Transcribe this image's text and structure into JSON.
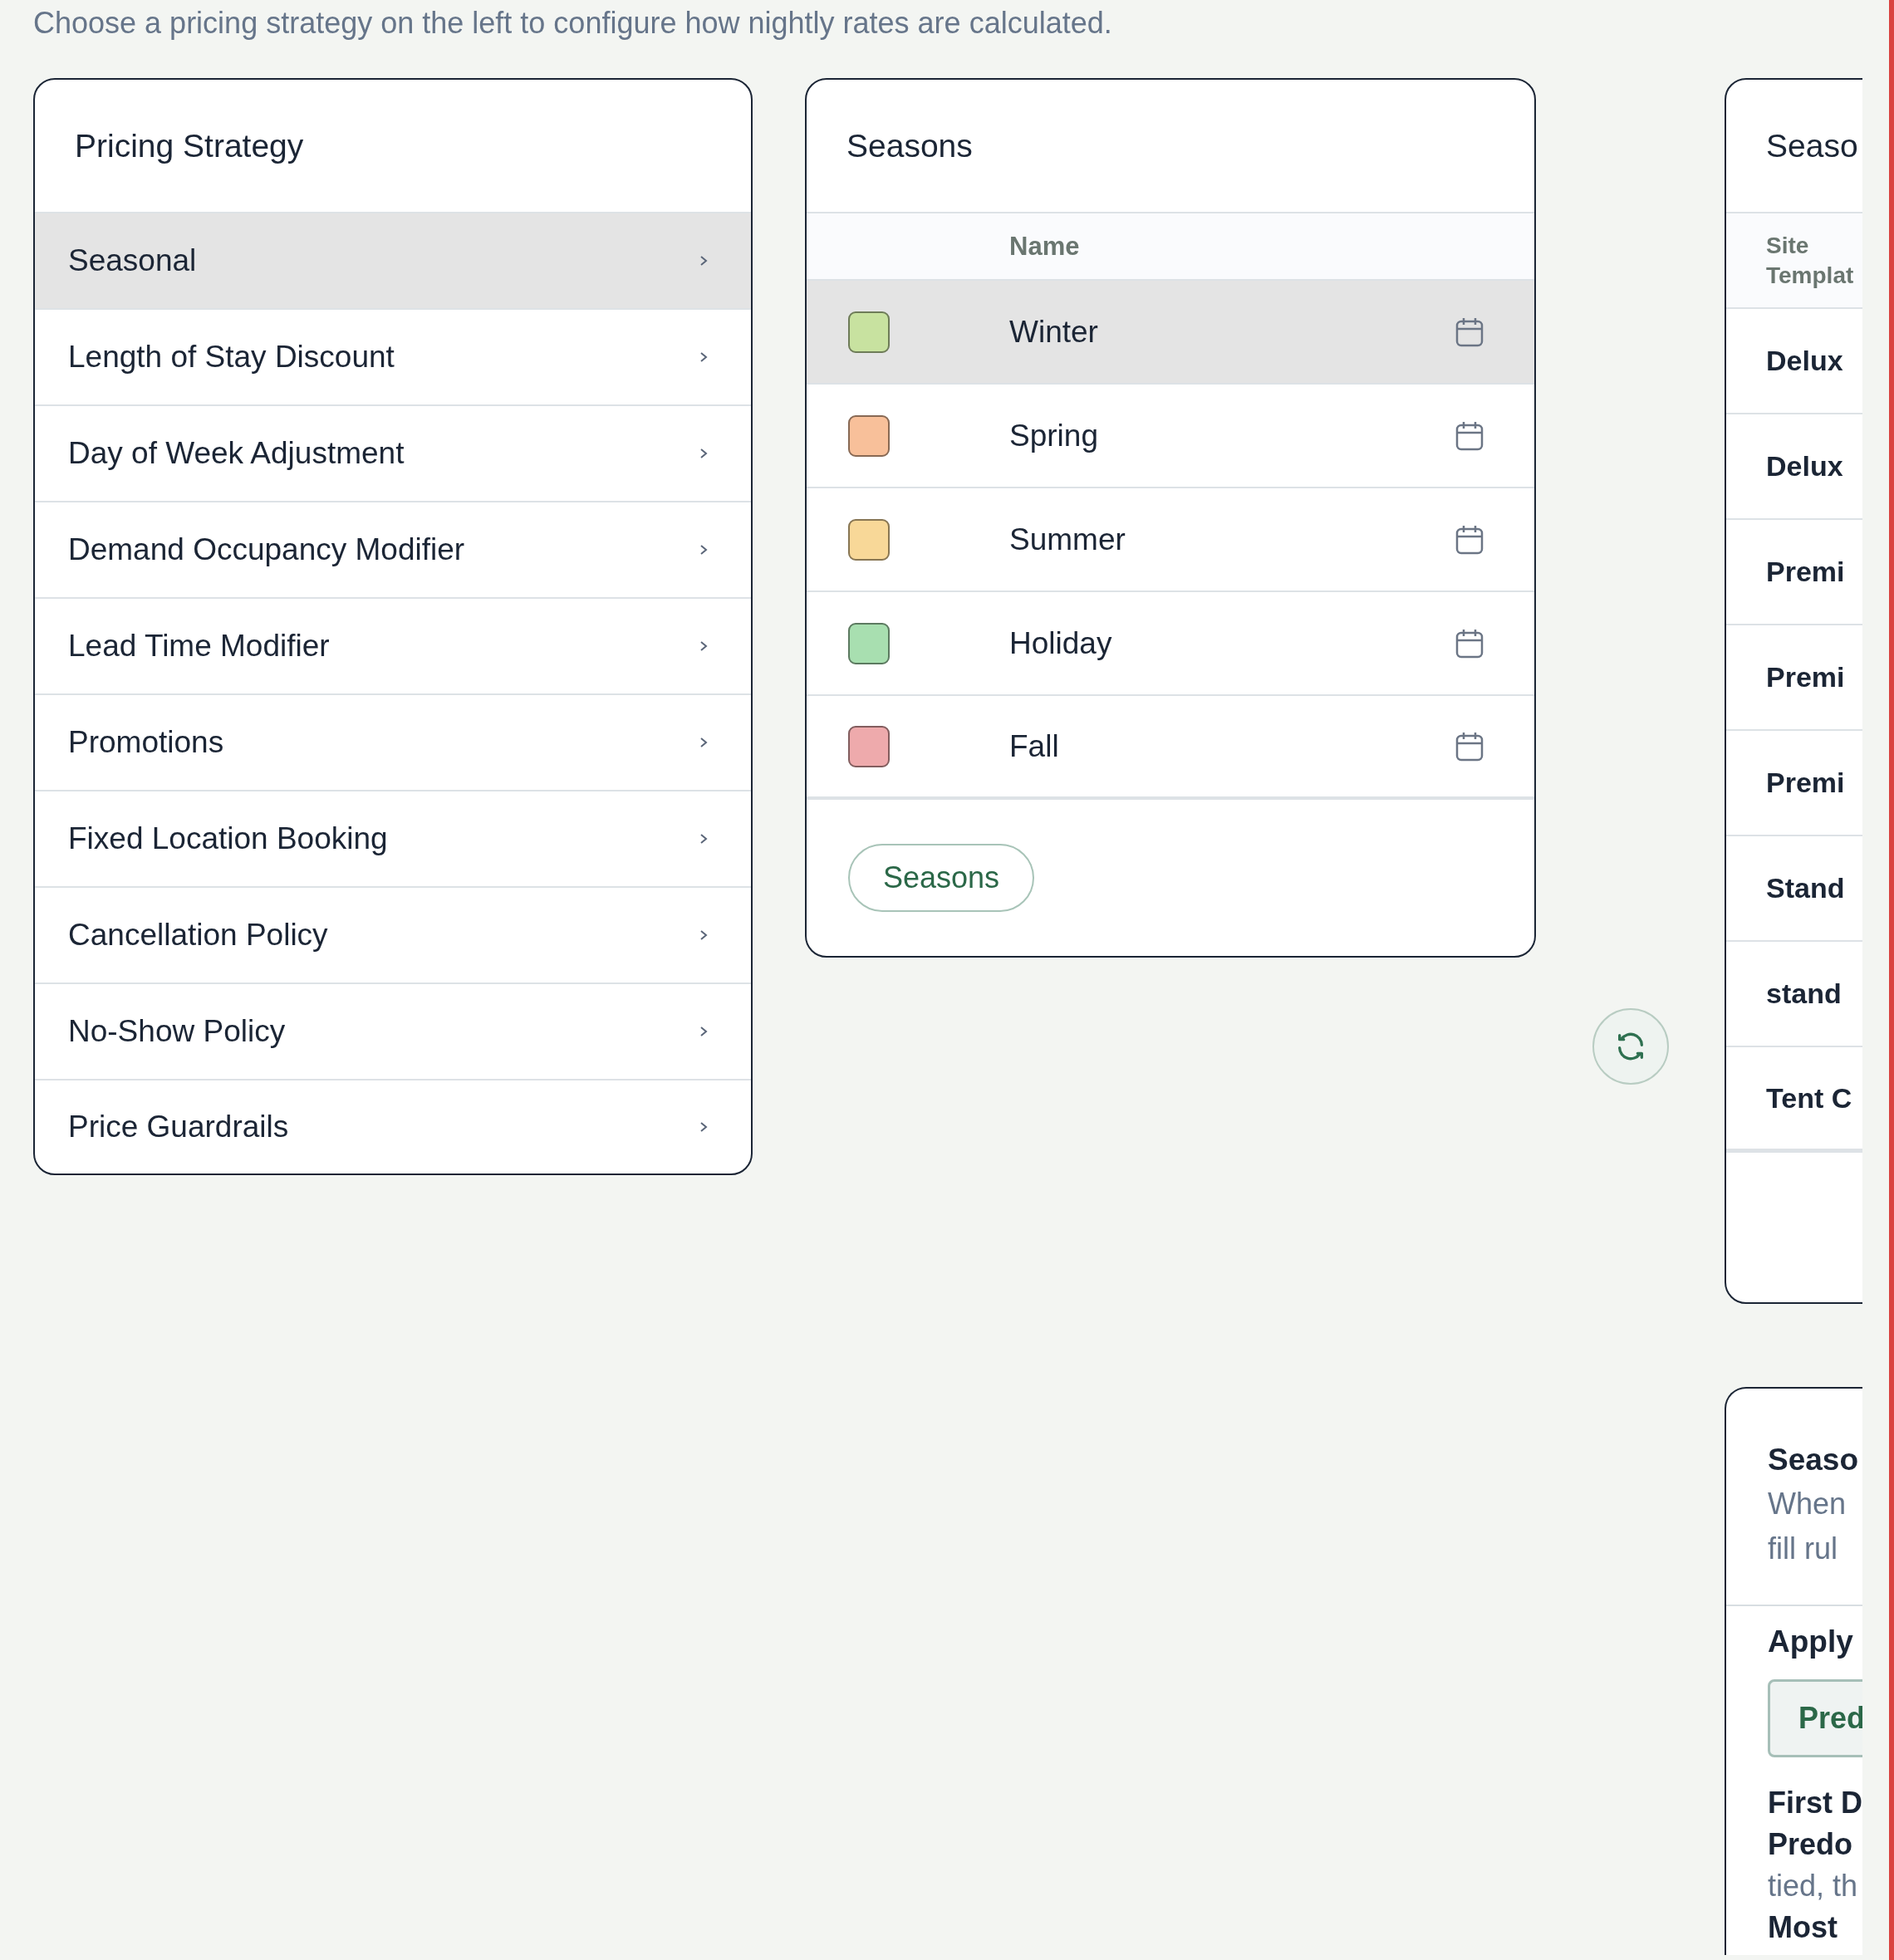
{
  "intro": "Choose a pricing strategy on the left to configure how nightly rates are calculated.",
  "strategy_panel": {
    "title": "Pricing Strategy",
    "items": [
      {
        "label": "Seasonal",
        "selected": true
      },
      {
        "label": "Length of Stay Discount",
        "selected": false
      },
      {
        "label": "Day of Week Adjustment",
        "selected": false
      },
      {
        "label": "Demand Occupancy Modifier",
        "selected": false
      },
      {
        "label": "Lead Time Modifier",
        "selected": false
      },
      {
        "label": "Promotions",
        "selected": false
      },
      {
        "label": "Fixed Location Booking",
        "selected": false
      },
      {
        "label": "Cancellation Policy",
        "selected": false
      },
      {
        "label": "No-Show Policy",
        "selected": false
      },
      {
        "label": "Price Guardrails",
        "selected": false
      }
    ]
  },
  "seasons_panel": {
    "title": "Seasons",
    "column": "Name",
    "rows": [
      {
        "name": "Winter",
        "color": "#c8e2a0",
        "selected": true
      },
      {
        "name": "Spring",
        "color": "#f8c09a",
        "selected": false
      },
      {
        "name": "Summer",
        "color": "#f8d898",
        "selected": false
      },
      {
        "name": "Holiday",
        "color": "#a8dfb0",
        "selected": false
      },
      {
        "name": "Fall",
        "color": "#eeaaac",
        "selected": false
      }
    ],
    "button": "Seasons"
  },
  "rates_panel": {
    "title": "Seaso",
    "column": "Site Templat",
    "rows": [
      "Delux",
      "Delux",
      "Premi",
      "Premi",
      "Premi",
      "Stand",
      "stand",
      "Tent C"
    ]
  },
  "rule_panel": {
    "title": "Seaso",
    "description_lines": [
      "When",
      "fill rul"
    ],
    "label": "Apply",
    "button": "Pred",
    "options": [
      {
        "kind": "heading",
        "text": "First D"
      },
      {
        "kind": "heading",
        "text": "Predo"
      },
      {
        "kind": "note",
        "text": "tied, th"
      },
      {
        "kind": "heading",
        "text": "Most"
      }
    ]
  }
}
